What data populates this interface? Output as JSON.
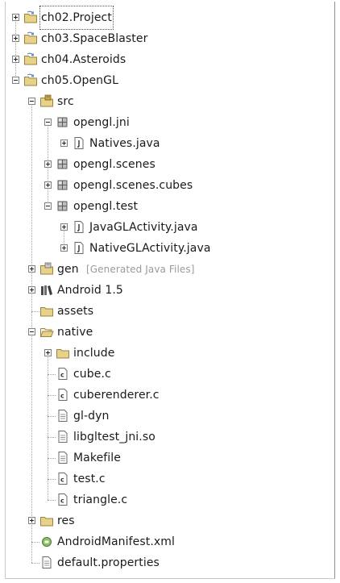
{
  "tree": [
    {
      "id": "ch02",
      "label": "ch02.Project",
      "icon": "project-folder-icon",
      "expander": "plus",
      "depth": 0
    },
    {
      "id": "ch03",
      "label": "ch03.SpaceBlaster",
      "icon": "project-folder-icon",
      "expander": "plus",
      "depth": 0
    },
    {
      "id": "ch04",
      "label": "ch04.Asteroids",
      "icon": "project-folder-icon",
      "expander": "plus",
      "depth": 0
    },
    {
      "id": "ch05",
      "label": "ch05.OpenGL",
      "icon": "project-folder-icon",
      "expander": "minus",
      "depth": 0
    },
    {
      "id": "src",
      "label": "src",
      "icon": "source-folder-icon",
      "expander": "minus",
      "depth": 1
    },
    {
      "id": "opengl-jni",
      "label": "opengl.jni",
      "icon": "package-icon",
      "expander": "minus",
      "depth": 2
    },
    {
      "id": "natives-java",
      "label": "Natives.java",
      "icon": "java-file-icon",
      "expander": "plus",
      "depth": 3
    },
    {
      "id": "opengl-scenes",
      "label": "opengl.scenes",
      "icon": "package-icon",
      "expander": "plus",
      "depth": 2
    },
    {
      "id": "opengl-scenes-cubes",
      "label": "opengl.scenes.cubes",
      "icon": "package-icon",
      "expander": "plus",
      "depth": 2
    },
    {
      "id": "opengl-test",
      "label": "opengl.test",
      "icon": "package-icon",
      "expander": "minus",
      "depth": 2
    },
    {
      "id": "javagl-activity",
      "label": "JavaGLActivity.java",
      "icon": "java-file-icon",
      "expander": "plus",
      "depth": 3
    },
    {
      "id": "nativegl-activity",
      "label": "NativeGLActivity.java",
      "icon": "java-file-icon",
      "expander": "plus",
      "depth": 3
    },
    {
      "id": "gen",
      "label": "gen",
      "decoration": "[Generated Java Files]",
      "icon": "generated-folder-icon",
      "expander": "plus",
      "depth": 1
    },
    {
      "id": "android-lib",
      "label": "Android 1.5",
      "icon": "library-icon",
      "expander": "plus",
      "depth": 1
    },
    {
      "id": "assets",
      "label": "assets",
      "icon": "folder-icon",
      "expander": "none",
      "depth": 1
    },
    {
      "id": "native",
      "label": "native",
      "icon": "open-folder-icon",
      "expander": "minus",
      "depth": 1
    },
    {
      "id": "include",
      "label": "include",
      "icon": "folder-icon",
      "expander": "plus",
      "depth": 2
    },
    {
      "id": "cube-c",
      "label": "cube.c",
      "icon": "c-file-icon",
      "expander": "none",
      "depth": 2
    },
    {
      "id": "cuberenderer-c",
      "label": "cuberenderer.c",
      "icon": "c-file-icon",
      "expander": "none",
      "depth": 2
    },
    {
      "id": "gl-dyn",
      "label": "gl-dyn",
      "icon": "text-file-icon",
      "expander": "none",
      "depth": 2
    },
    {
      "id": "libgltest-so",
      "label": "libgltest_jni.so",
      "icon": "text-file-icon",
      "expander": "none",
      "depth": 2
    },
    {
      "id": "makefile",
      "label": "Makefile",
      "icon": "text-file-icon",
      "expander": "none",
      "depth": 2
    },
    {
      "id": "test-c",
      "label": "test.c",
      "icon": "c-file-icon",
      "expander": "none",
      "depth": 2
    },
    {
      "id": "triangle-c",
      "label": "triangle.c",
      "icon": "c-file-icon",
      "expander": "none",
      "depth": 2
    },
    {
      "id": "res",
      "label": "res",
      "icon": "folder-icon",
      "expander": "plus",
      "depth": 1
    },
    {
      "id": "manifest",
      "label": "AndroidManifest.xml",
      "icon": "android-manifest-icon",
      "expander": "none",
      "depth": 1
    },
    {
      "id": "default-props",
      "label": "default.properties",
      "icon": "text-file-icon",
      "expander": "none",
      "depth": 1
    }
  ],
  "colors": {
    "folder": "#e7d28a",
    "folder_stroke": "#9c8240",
    "package": "#8a8a8a",
    "file": "#ffffff",
    "file_stroke": "#6a6a6a",
    "tree_lines": "#a0a0a0",
    "decoration_text": "#9a9a9a"
  }
}
